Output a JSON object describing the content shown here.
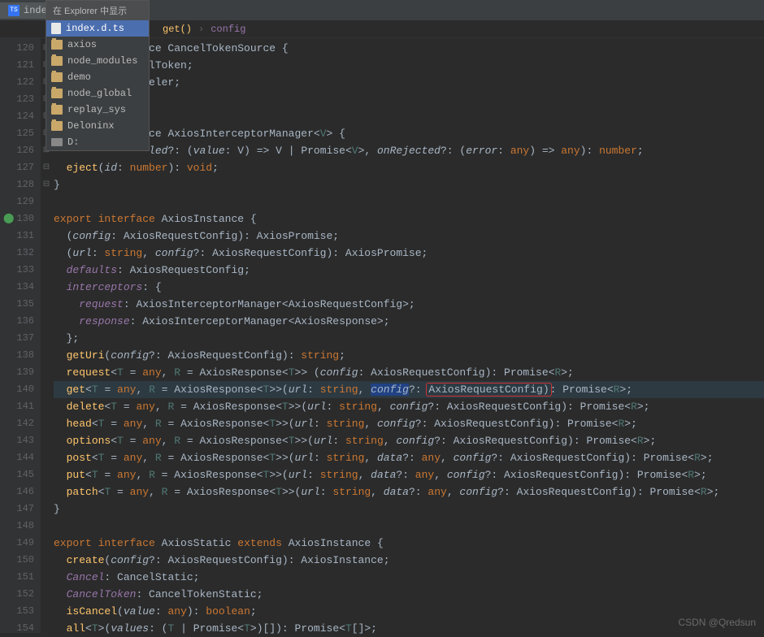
{
  "tab": {
    "label": "inde",
    "icon": "TS"
  },
  "breadcrumb": {
    "fn": "get()",
    "var": "config"
  },
  "contextMenu": {
    "title": "在 Explorer 中显示",
    "items": [
      {
        "label": "index.d.ts",
        "type": "file",
        "selected": true
      },
      {
        "label": "axios",
        "type": "folder"
      },
      {
        "label": "node_modules",
        "type": "folder"
      },
      {
        "label": "demo",
        "type": "folder"
      },
      {
        "label": "node_global",
        "type": "folder"
      },
      {
        "label": "replay_sys",
        "type": "folder"
      },
      {
        "label": "Deloninx",
        "type": "folder"
      },
      {
        "label": "D:",
        "type": "drive"
      }
    ]
  },
  "lineStart": 120,
  "lineEnd": 154,
  "highlightedLine": 140,
  "modifiedLine": 130,
  "code": {
    "l120": {
      "text": "ce CancelTokenSource {"
    },
    "l121": {
      "text": "lToken;"
    },
    "l122": {
      "text": "eler;"
    },
    "l125": {
      "pre": "ce ",
      "cls": "AxiosInterceptorManager",
      "post1": "<",
      "gen": "V",
      "post2": "> {"
    },
    "l126": {
      "p1": "led",
      "p2": "value",
      "p3": "V",
      "p4": "Promise",
      "p5": "V",
      "p6": "onRejected",
      "p7": "error",
      "p8": "any",
      "p9": "any",
      "p10": "number"
    },
    "l127": {
      "fn": "eject",
      "param": "id",
      "type": "number",
      "ret": "void"
    },
    "l130": {
      "kw1": "export",
      "kw2": "interface",
      "cls": "AxiosInstance"
    },
    "l131": {
      "p": "config",
      "t1": "AxiosRequestConfig",
      "t2": "AxiosPromise"
    },
    "l132": {
      "p1": "url",
      "t1": "string",
      "p2": "config",
      "t2": "AxiosRequestConfig",
      "t3": "AxiosPromise"
    },
    "l133": {
      "prop": "defaults",
      "t": "AxiosRequestConfig"
    },
    "l134": {
      "prop": "interceptors"
    },
    "l135": {
      "prop": "request",
      "t1": "AxiosInterceptorManager",
      "t2": "AxiosRequestConfig"
    },
    "l136": {
      "prop": "response",
      "t1": "AxiosInterceptorManager",
      "t2": "AxiosResponse"
    },
    "l138": {
      "fn": "getUri",
      "p": "config",
      "t1": "AxiosRequestConfig",
      "ret": "string"
    },
    "l139": {
      "fn": "request",
      "g1": "T",
      "a": "any",
      "g2": "R",
      "t1": "AxiosResponse",
      "p": "config",
      "t2": "AxiosRequestConfig",
      "t3": "Promise"
    },
    "l140": {
      "fn": "get",
      "g1": "T",
      "a": "any",
      "g2": "R",
      "t1": "AxiosResponse",
      "p1": "url",
      "pt1": "string",
      "p2": "config",
      "t2": "AxiosRequestConfig",
      "t3": "Promise"
    },
    "l141": {
      "fn": "delete",
      "g1": "T",
      "a": "any",
      "g2": "R",
      "t1": "AxiosResponse",
      "p1": "url",
      "pt1": "string",
      "p2": "config",
      "t2": "AxiosRequestConfig",
      "t3": "Promise"
    },
    "l142": {
      "fn": "head",
      "g1": "T",
      "a": "any",
      "g2": "R",
      "t1": "AxiosResponse",
      "p1": "url",
      "pt1": "string",
      "p2": "config",
      "t2": "AxiosRequestConfig",
      "t3": "Promise"
    },
    "l143": {
      "fn": "options",
      "g1": "T",
      "a": "any",
      "g2": "R",
      "t1": "AxiosResponse",
      "p1": "url",
      "pt1": "string",
      "p2": "config",
      "t2": "AxiosRequestConfig",
      "t3": "Promise"
    },
    "l144": {
      "fn": "post",
      "g1": "T",
      "a": "any",
      "g2": "R",
      "t1": "AxiosResponse",
      "p1": "url",
      "pt1": "string",
      "p2": "data",
      "p3": "config",
      "t2": "AxiosRequestConfig",
      "t3": "Promise"
    },
    "l145": {
      "fn": "put",
      "g1": "T",
      "a": "any",
      "g2": "R",
      "t1": "AxiosResponse",
      "p1": "url",
      "pt1": "string",
      "p2": "data",
      "p3": "config",
      "t2": "AxiosRequestConfig",
      "t3": "Promise"
    },
    "l146": {
      "fn": "patch",
      "g1": "T",
      "a": "any",
      "g2": "R",
      "t1": "AxiosResponse",
      "p1": "url",
      "pt1": "string",
      "p2": "data",
      "p3": "config",
      "t2": "AxiosRequestConfig",
      "t3": "Promise"
    },
    "l149": {
      "kw1": "export",
      "kw2": "interface",
      "cls": "AxiosStatic",
      "kw3": "extends",
      "cls2": "AxiosInstance"
    },
    "l150": {
      "fn": "create",
      "p": "config",
      "t1": "AxiosRequestConfig",
      "t2": "AxiosInstance"
    },
    "l151": {
      "prop": "Cancel",
      "t": "CancelStatic"
    },
    "l152": {
      "prop": "CancelToken",
      "t": "CancelTokenStatic"
    },
    "l153": {
      "fn": "isCancel",
      "p": "value",
      "t": "any",
      "ret": "boolean"
    },
    "l154": {
      "fn": "all",
      "g": "T",
      "p": "values",
      "t1": "T",
      "t2": "Promise",
      "t3": "Promise"
    }
  },
  "watermark": "CSDN @Qredsun"
}
